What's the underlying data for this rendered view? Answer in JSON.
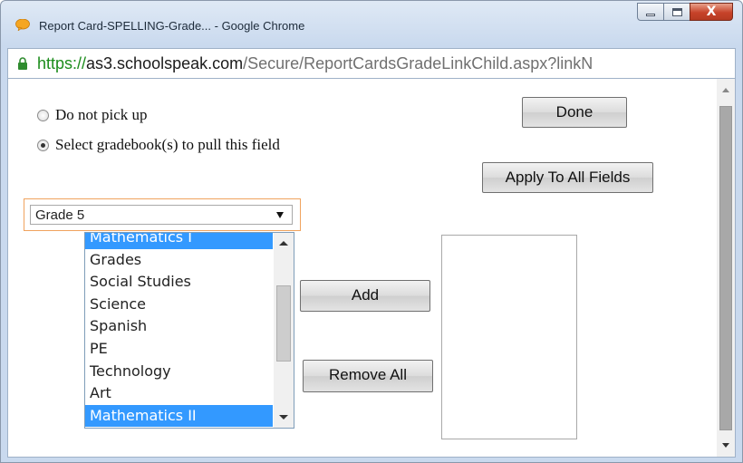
{
  "window": {
    "title": "Report Card-SPELLING-Grade... - Google Chrome",
    "controls": {
      "minimize": "minimize",
      "maximize": "maximize",
      "close": "X"
    }
  },
  "address": {
    "scheme": "https://",
    "host": "as3.schoolspeak.com",
    "path": "/Secure/ReportCardsGradeLinkChild.aspx?linkN"
  },
  "options": {
    "no_pickup": "Do not pick up",
    "select_gradebook": "Select gradebook(s) to pull this field",
    "selected": "select_gradebook"
  },
  "buttons": {
    "done": "Done",
    "apply_all": "Apply To All Fields",
    "add": "Add",
    "remove_all": "Remove All"
  },
  "grade_select": {
    "value": "Grade 5"
  },
  "gradebook_list": {
    "items": [
      {
        "label": "Mathematics I",
        "selected": true
      },
      {
        "label": "Grades",
        "selected": false
      },
      {
        "label": "Social Studies",
        "selected": false
      },
      {
        "label": "Science",
        "selected": false
      },
      {
        "label": "Spanish",
        "selected": false
      },
      {
        "label": "PE",
        "selected": false
      },
      {
        "label": "Technology",
        "selected": false
      },
      {
        "label": "Art",
        "selected": false
      },
      {
        "label": "Mathematics II",
        "selected": true
      }
    ]
  },
  "icons": {
    "app": "chrome-speech-bubble-icon",
    "secure": "lock-icon"
  },
  "colors": {
    "selection": "#3399ff",
    "url_scheme": "#1b8c1b",
    "focus_border": "#f0a35e"
  }
}
